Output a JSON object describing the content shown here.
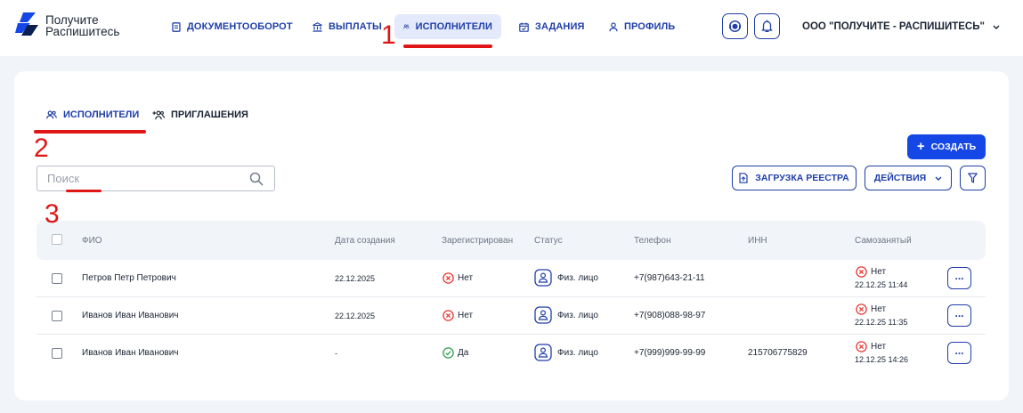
{
  "brand": {
    "line1": "Получите",
    "line2": "Распишитесь"
  },
  "nav": [
    {
      "label": "ДОКУМЕНТООБОРОТ",
      "icon": "document-icon",
      "active": false
    },
    {
      "label": "ВЫПЛАТЫ",
      "icon": "bank-icon",
      "active": false
    },
    {
      "label": "ИСПОЛНИТЕЛИ",
      "icon": "users-icon",
      "active": true
    },
    {
      "label": "ЗАДАНИЯ",
      "icon": "calendar-icon",
      "active": false
    },
    {
      "label": "ПРОФИЛЬ",
      "icon": "user-icon",
      "active": false
    }
  ],
  "header_icons": [
    "support-icon",
    "bell-icon"
  ],
  "organization": "ООО \"ПОЛУЧИТЕ - РАСПИШИТЕСЬ\"",
  "annotations": [
    "1",
    "2",
    "3"
  ],
  "tabs": [
    {
      "label": "ИСПОЛНИТЕЛИ",
      "icon": "users-icon",
      "active": true
    },
    {
      "label": "ПРИГЛАШЕНИЯ",
      "icon": "add-users-icon",
      "active": false
    }
  ],
  "toolbar": {
    "create_label": "СОЗДАТЬ",
    "upload_label": "ЗАГРУЗКА РЕЕСТРА",
    "actions_label": "ДЕЙСТВИЯ",
    "search_placeholder": "Поиск",
    "search_value": ""
  },
  "table": {
    "columns": [
      "ФИО",
      "Дата создания",
      "Зарегистрирован",
      "Статус",
      "Телефон",
      "ИНН",
      "Самозанятый"
    ],
    "rows": [
      {
        "name": "Петров Петр Петрович",
        "created": "22.12.2025",
        "registered": "Нет",
        "registered_ok": false,
        "status": "Физ. лицо",
        "phone": "+7(987)643-21-11",
        "inn": "",
        "self_employed": "Нет",
        "self_employed_date": "22.12.25 11:44"
      },
      {
        "name": "Иванов Иван Иванович",
        "created": "22.12.2025",
        "registered": "Нет",
        "registered_ok": false,
        "status": "Физ. лицо",
        "phone": "+7(908)088-98-97",
        "inn": "",
        "self_employed": "Нет",
        "self_employed_date": "22.12.25 11:35"
      },
      {
        "name": "Иванов Иван Иванович",
        "created": "-",
        "registered": "Да",
        "registered_ok": true,
        "status": "Физ. лицо",
        "phone": "+7(999)999-99-99",
        "inn": "215706775829",
        "self_employed": "Нет",
        "self_employed_date": "12.12.25 14:26"
      }
    ],
    "row_action_label": "..."
  },
  "colors": {
    "accent": "#1447e6",
    "nav": "#1f3fa8",
    "error": "#e53935",
    "success": "#2e9e4f",
    "annotation": "#e01515"
  }
}
